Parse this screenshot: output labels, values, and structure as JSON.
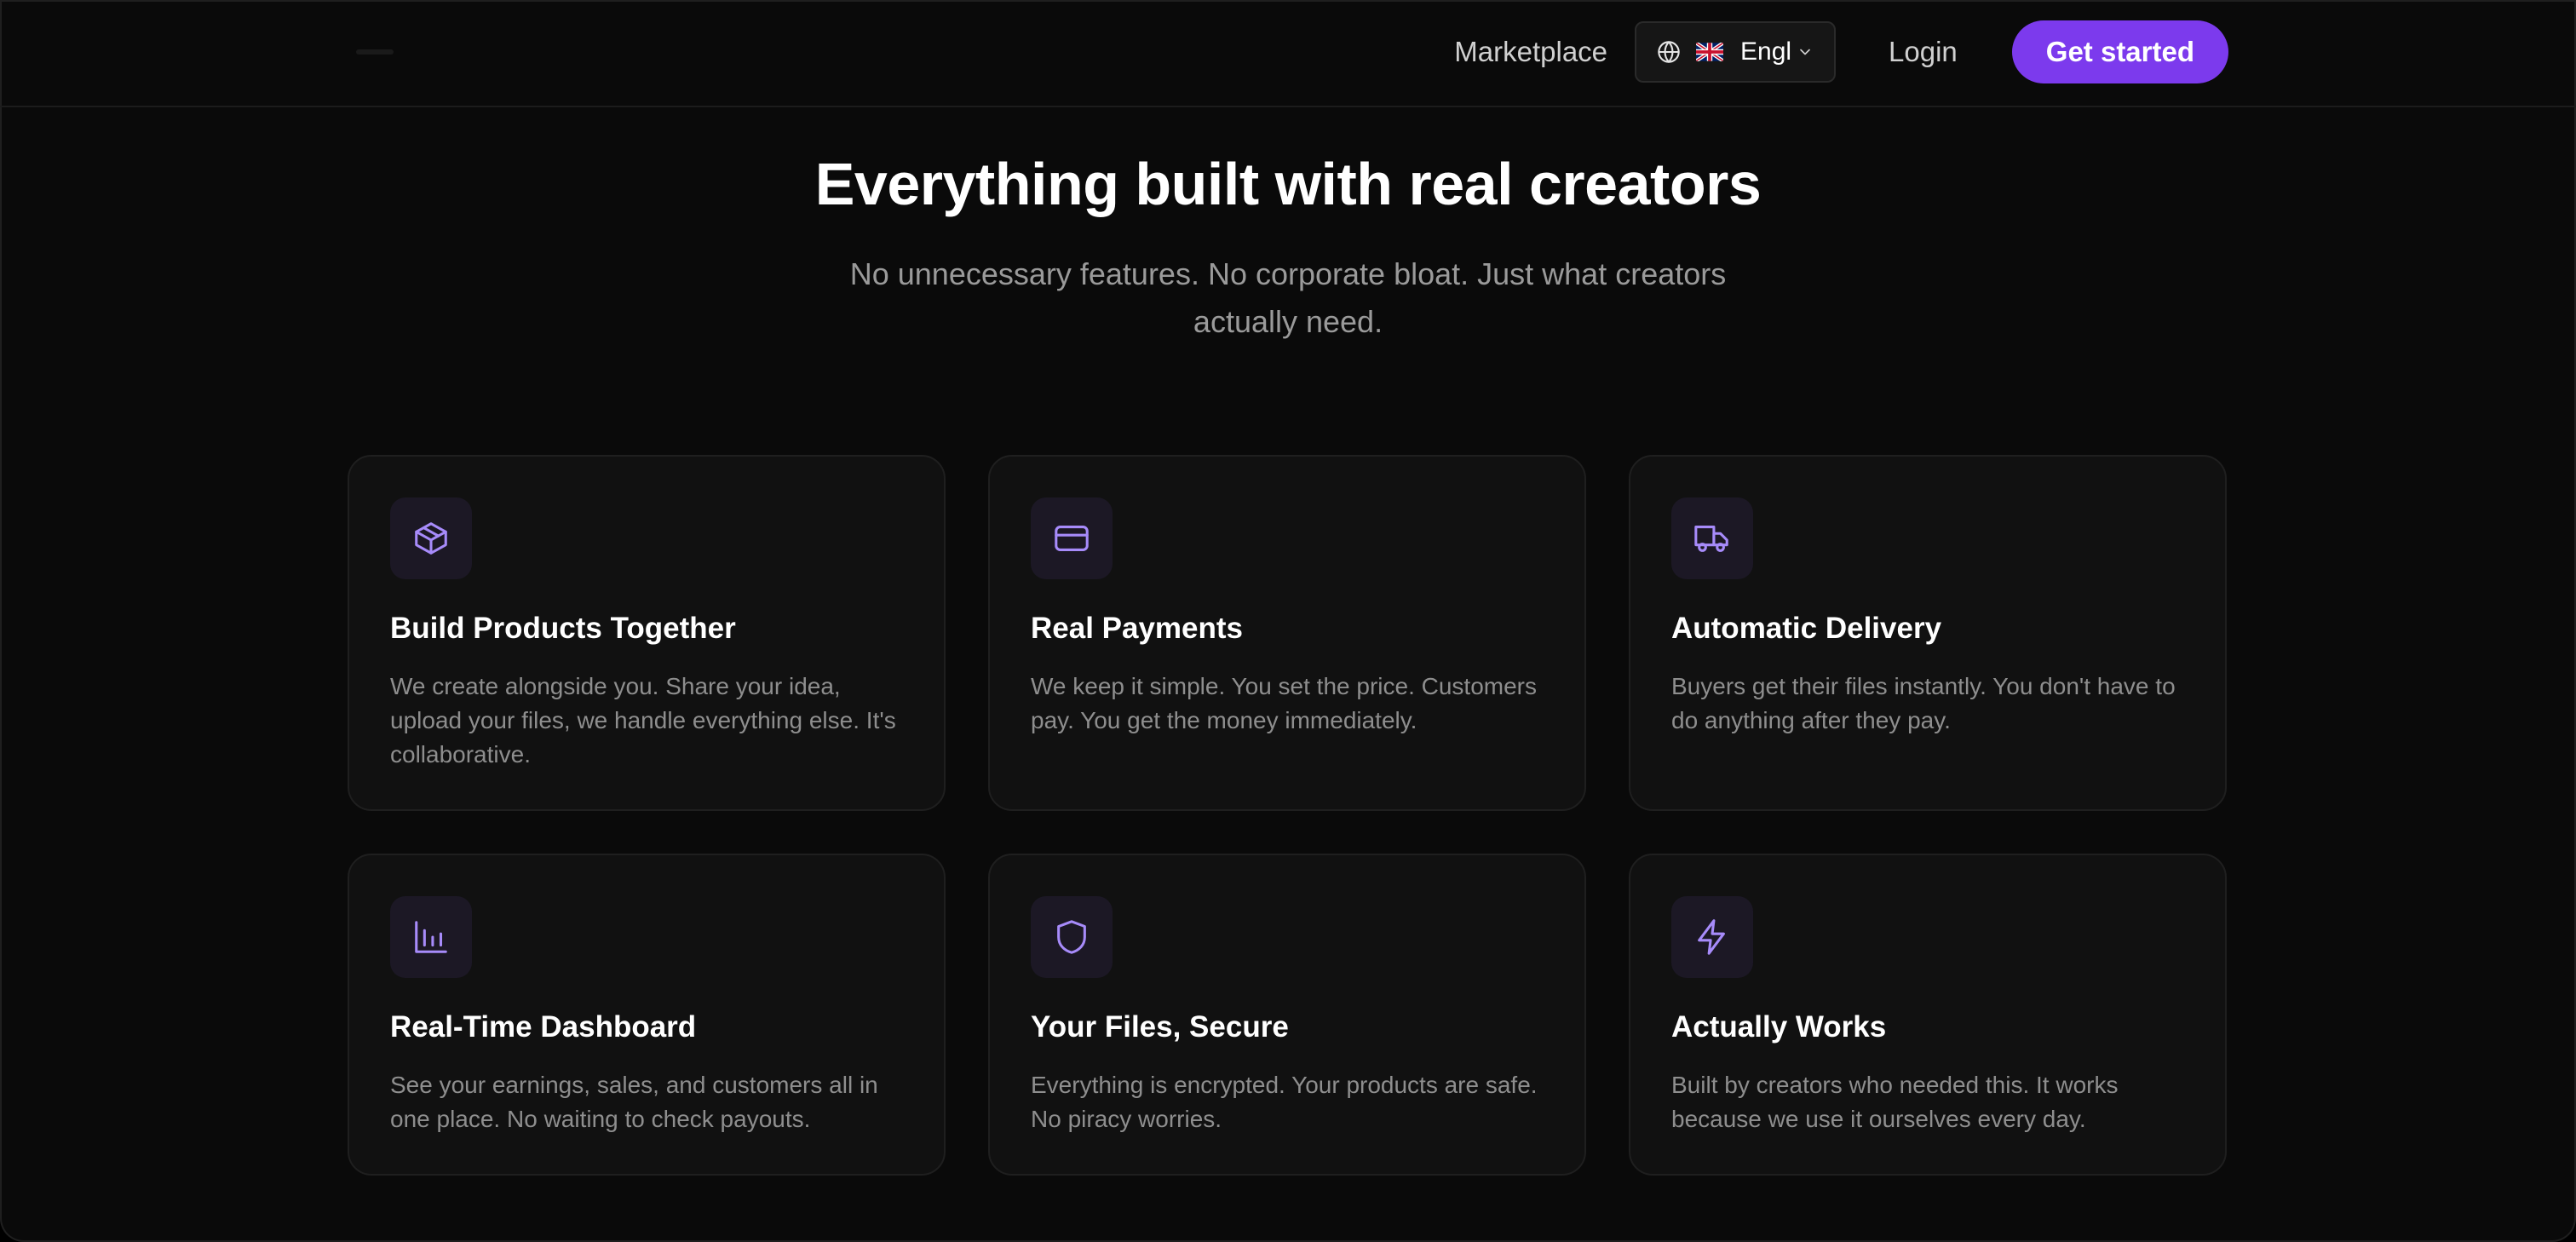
{
  "header": {
    "nav": {
      "marketplace": "Marketplace",
      "language": "Engli",
      "login": "Login",
      "get_started": "Get started"
    }
  },
  "hero": {
    "title": "Everything built with real creators",
    "subtitle": "No unnecessary features. No corporate bloat. Just what creators actually need."
  },
  "features": [
    {
      "icon": "package-icon",
      "title": "Build Products Together",
      "description": "We create alongside you. Share your idea, upload your files, we handle everything else. It's collaborative."
    },
    {
      "icon": "credit-card-icon",
      "title": "Real Payments",
      "description": "We keep it simple. You set the price. Customers pay. You get the money immediately."
    },
    {
      "icon": "truck-icon",
      "title": "Automatic Delivery",
      "description": "Buyers get their files instantly. You don't have to do anything after they pay."
    },
    {
      "icon": "bar-chart-icon",
      "title": "Real-Time Dashboard",
      "description": "See your earnings, sales, and customers all in one place. No waiting to check payouts."
    },
    {
      "icon": "shield-icon",
      "title": "Your Files, Secure",
      "description": "Everything is encrypted. Your products are safe. No piracy worries."
    },
    {
      "icon": "lightning-icon",
      "title": "Actually Works",
      "description": "Built by creators who needed this. It works because we use it ourselves every day."
    }
  ],
  "colors": {
    "background": "#0a0a0a",
    "card_background": "#111111",
    "card_border": "#1f1f1f",
    "accent": "#7c3aed",
    "icon_accent": "#a78bfa",
    "icon_box_background": "#1c1825",
    "title_text": "#ffffff",
    "muted_text": "#8e8e8e"
  }
}
